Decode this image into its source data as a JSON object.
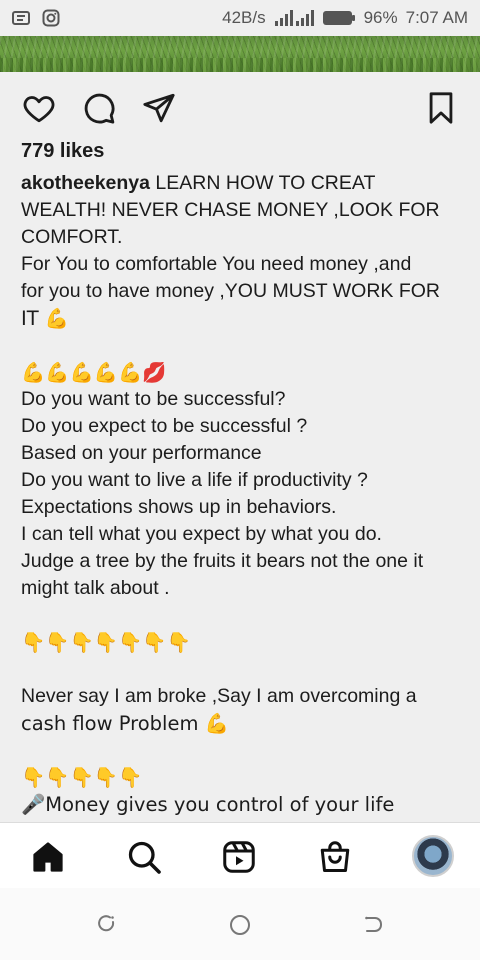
{
  "status_bar": {
    "speed": "42B/s",
    "battery": "96%",
    "time": "7:07 AM"
  },
  "post": {
    "likes": "779 likes",
    "username": "akotheekenya",
    "caption_lines": [
      " LEARN HOW TO CREAT",
      "WEALTH! NEVER CHASE MONEY ,LOOK FOR",
      "COMFORT.",
      "For You to comfortable You need money ,and",
      "for you to have money ,YOU MUST WORK FOR",
      "IT 💪",
      "",
      "💪💪💪💪💪💋",
      "Do you want to be successful?",
      "Do you expect to be successful ?",
      "Based on your performance",
      "Do you want to live a life if productivity ?",
      "Expectations shows up in behaviors.",
      "I can tell what you expect by what you do.",
      "Judge a tree by the fruits it bears not the one it",
      "might talk about .",
      "",
      "👇👇👇👇👇👇👇",
      "",
      "Never say I am broke ,Say I am overcoming a",
      "cash flow Problem 💪",
      "",
      "👇👇👇👇👇",
      "🎤Money gives you control of your life"
    ]
  },
  "icons": {
    "like": "heart-icon",
    "comment": "comment-icon",
    "share": "send-icon",
    "save": "bookmark-icon",
    "home": "home-icon",
    "search": "search-icon",
    "reels": "reels-icon",
    "shop": "shop-icon"
  },
  "colors": {
    "background": "#efefef",
    "text": "#1c1c1c",
    "nav_bg": "#ffffff"
  }
}
